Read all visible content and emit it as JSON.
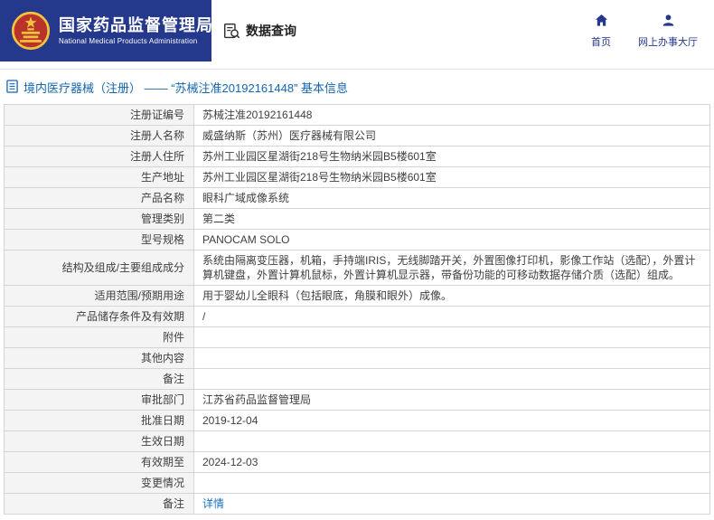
{
  "header": {
    "org_name_cn": "国家药品监督管理局",
    "org_name_en": "National Medical Products Administration",
    "nav_data_query": "数据查询",
    "nav_home": "首页",
    "nav_hall": "网上办事大厅"
  },
  "page": {
    "title": "境内医疗器械（注册） —— “苏械注准20192161448” 基本信息"
  },
  "colors": {
    "brand_blue": "#24388c",
    "title_blue": "#1565af",
    "link_blue": "#1a73c0",
    "emblem_gold": "#f2c13e",
    "label_cell_gray": "#f4f4f4",
    "border_gray": "#d4d4d4"
  },
  "icons": {
    "emblem": "national-emblem-icon",
    "data_query": "document-search-icon",
    "home": "home-icon",
    "hall": "person-icon",
    "title": "document-icon"
  },
  "table": {
    "rows": [
      {
        "label": "注册证编号",
        "value": "苏械注准20192161448"
      },
      {
        "label": "注册人名称",
        "value": "威盛纳斯（苏州）医疗器械有限公司"
      },
      {
        "label": "注册人住所",
        "value": "苏州工业园区星湖街218号生物纳米园B5楼601室"
      },
      {
        "label": "生产地址",
        "value": "苏州工业园区星湖街218号生物纳米园B5楼601室"
      },
      {
        "label": "产品名称",
        "value": "眼科广域成像系统"
      },
      {
        "label": "管理类别",
        "value": "第二类"
      },
      {
        "label": "型号规格",
        "value": "PANOCAM SOLO"
      },
      {
        "label": "结构及组成/主要组成成分",
        "value": "系统由隔离变压器，机箱，手持端IRIS，无线脚踏开关，外置图像打印机，影像工作站（选配），外置计算机键盘，外置计算机鼠标，外置计算机显示器，带备份功能的可移动数据存储介质（选配）组成。"
      },
      {
        "label": "适用范围/预期用途",
        "value": "用于婴幼儿全眼科（包括眼底，角膜和眼外）成像。"
      },
      {
        "label": "产品储存条件及有效期",
        "value": "/"
      },
      {
        "label": "附件",
        "value": ""
      },
      {
        "label": "其他内容",
        "value": ""
      },
      {
        "label": "备注",
        "value": ""
      },
      {
        "label": "审批部门",
        "value": "江苏省药品监督管理局"
      },
      {
        "label": "批准日期",
        "value": "2019-12-04"
      },
      {
        "label": "生效日期",
        "value": ""
      },
      {
        "label": "有效期至",
        "value": "2024-12-03"
      },
      {
        "label": "变更情况",
        "value": ""
      },
      {
        "label": "备注",
        "value": "详情"
      }
    ]
  }
}
